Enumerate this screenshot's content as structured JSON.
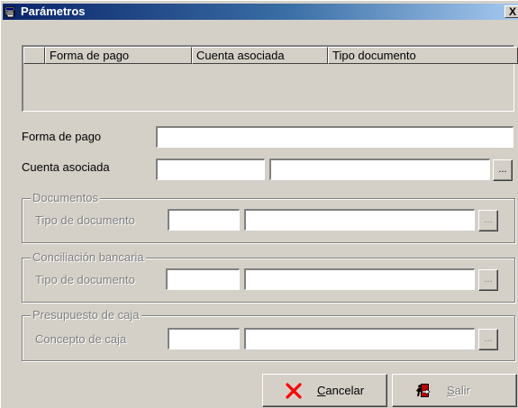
{
  "window": {
    "title": "Parámetros",
    "close_label": "X"
  },
  "grid": {
    "columns": [
      "Forma de pago",
      "Cuenta asociada",
      "Tipo documento"
    ]
  },
  "form": {
    "forma_pago_label": "Forma de pago",
    "forma_pago_value": "",
    "cuenta_asociada_label": "Cuenta asociada",
    "cuenta_code_value": "",
    "cuenta_desc_value": "",
    "lookup_label": "..."
  },
  "documentos": {
    "legend": "Documentos",
    "label": "Tipo de documento",
    "code_value": "",
    "desc_value": ""
  },
  "conciliacion": {
    "legend": "Conciliación bancaria",
    "label": "Tipo de documento",
    "code_value": "",
    "desc_value": ""
  },
  "presupuesto": {
    "legend": "Presupuesto de caja",
    "label": "Concepto de caja",
    "code_value": "",
    "desc_value": ""
  },
  "buttons": {
    "cancel_mnemonic": "C",
    "cancel_rest": "ancelar",
    "exit_mnemonic": "S",
    "exit_rest": "alir"
  },
  "colors": {
    "face": "#d4d0c8",
    "title_active": "#0a246a",
    "cancel_icon": "#ff0000",
    "disabled_text": "#808080"
  },
  "icons": {
    "title": "parameters-app-icon",
    "cancel": "red-x-icon",
    "exit": "exit-door-icon"
  }
}
